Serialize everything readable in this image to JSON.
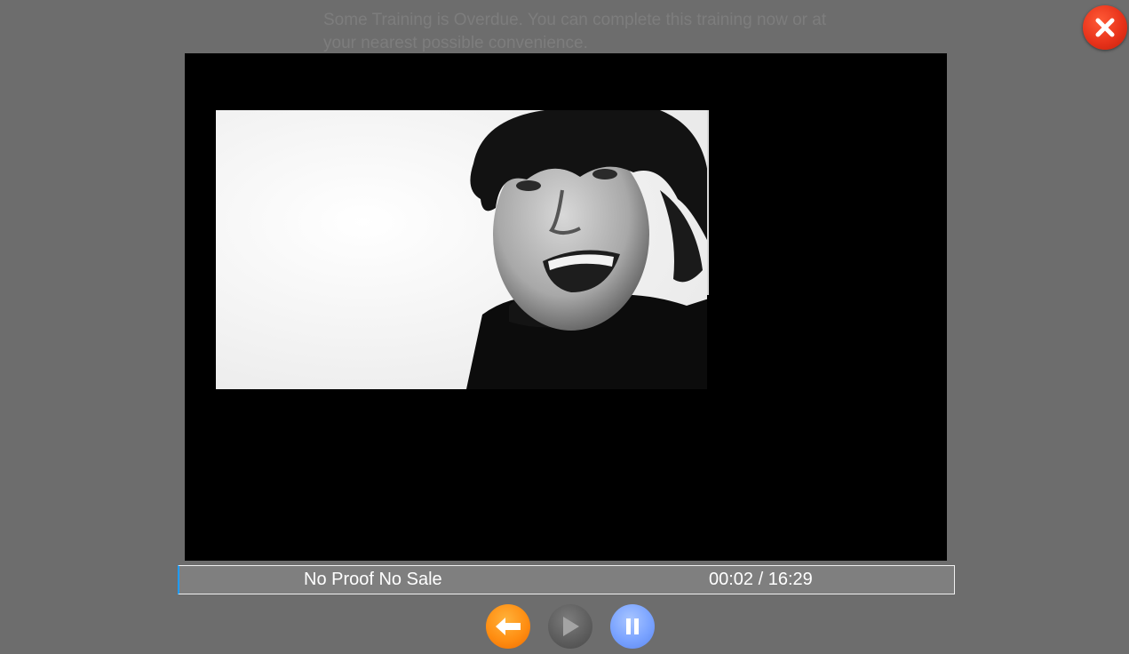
{
  "notice": {
    "text": "Some Training is Overdue. You can complete this training now or at your nearest possible convenience."
  },
  "player": {
    "title": "No Proof No Sale",
    "time": "00:02 / 16:29"
  },
  "icons": {
    "close": "close-icon",
    "back": "back-arrow-icon",
    "play": "play-icon",
    "pause": "pause-icon"
  },
  "colors": {
    "background": "#6d6d6d",
    "close": "#e8331b",
    "back": "#ff8e12",
    "play": "#5c5c5c",
    "pause": "#7aa3ff",
    "bar": "#7f7f7f"
  }
}
